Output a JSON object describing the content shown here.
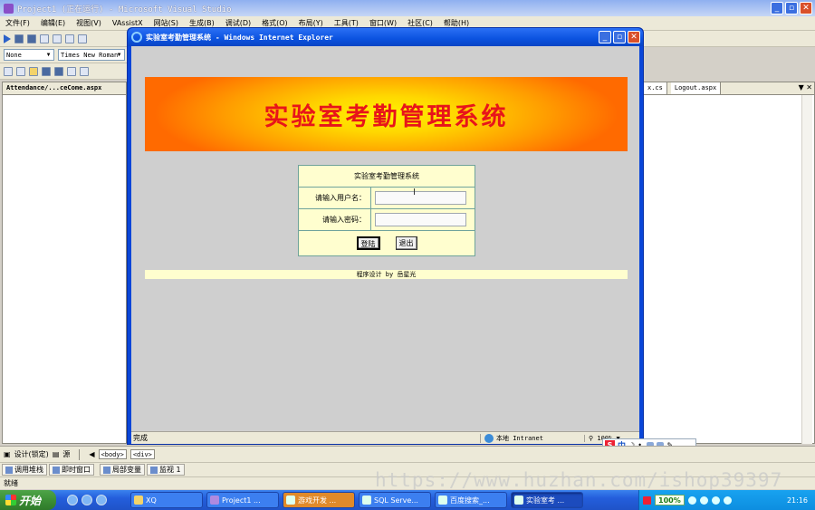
{
  "vs": {
    "title": "Project1 (正在运行) - Microsoft Visual Studio",
    "menu": [
      "文件(F)",
      "编辑(E)",
      "视图(V)",
      "VAssistX",
      "网站(S)",
      "生成(B)",
      "调试(D)",
      "格式(O)",
      "布局(Y)",
      "工具(T)",
      "窗口(W)",
      "社区(C)",
      "帮助(H)"
    ],
    "toolbar": {
      "block_combo": "None",
      "font_combo": "Times New Roman"
    },
    "left_tab": "Attendance/...ceCome.aspx",
    "right_tabs": [
      "x.cs",
      "Logout.aspx"
    ],
    "design_tab": "设计(锁定)",
    "source_tab": "源",
    "breadcrumb": [
      "<body>",
      "<div>"
    ],
    "debug_tabs": [
      "调用堆栈",
      "即时窗口",
      "局部变量",
      "监视 1"
    ],
    "status": "就绪"
  },
  "ie": {
    "title": "实验室考勤管理系统 - Windows Internet Explorer",
    "status_done": "完成",
    "zone": "本地 Intranet",
    "zoom": "100%"
  },
  "page": {
    "banner": "实验室考勤管理系统",
    "login": {
      "header": "实验室考勤管理系统",
      "username_label": "请输入用户名：",
      "password_label": "请输入密码：",
      "username_value": "",
      "password_value": "",
      "login_button": "登陆",
      "exit_button": "退出"
    },
    "footer": "程序设计 by 岳星光"
  },
  "ime": {
    "mode": "中"
  },
  "watermark": "https://www.huzhan.com/ishop39397",
  "taskbar": {
    "start": "开始",
    "tasks": [
      "XQ",
      "Project1 ...",
      "游戏开发 ...",
      "SQL Serve...",
      "百度搜索_...",
      "实验室考 ..."
    ],
    "tray_percent": "100%",
    "clock": "21:16"
  }
}
